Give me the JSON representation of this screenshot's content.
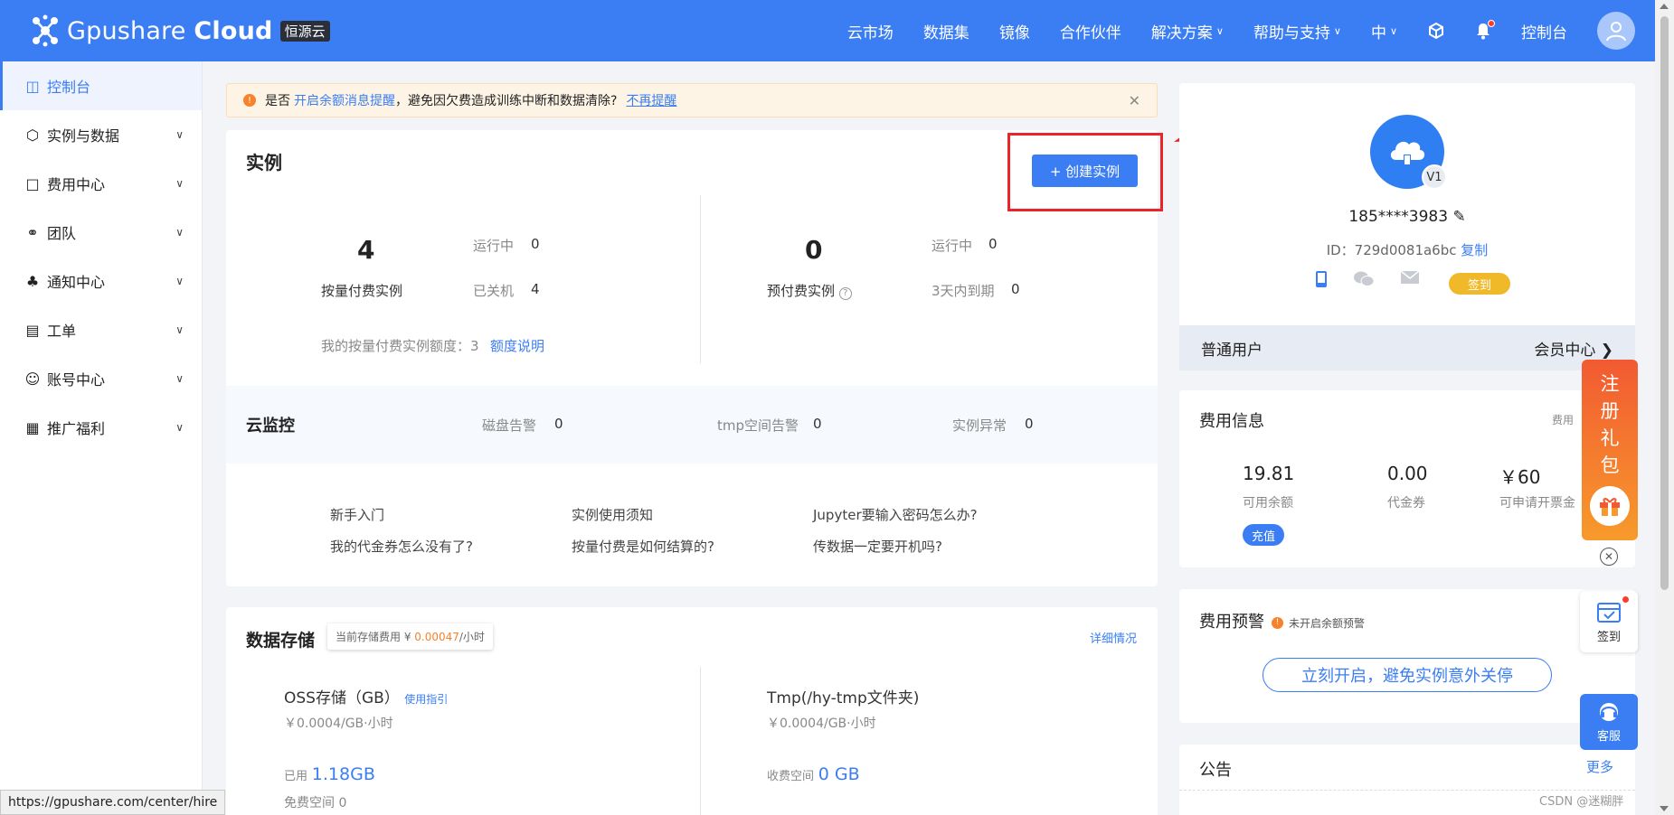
{
  "header": {
    "logo_text_a": "Gpushare ",
    "logo_text_b": "Cloud",
    "logo_badge": "恒源云",
    "nav": [
      "云市场",
      "数据集",
      "镜像",
      "合作伙伴",
      "解决方案",
      "帮助与支持",
      "中",
      "控制台"
    ]
  },
  "sidebar": {
    "items": [
      {
        "label": "控制台"
      },
      {
        "label": "实例与数据"
      },
      {
        "label": "费用中心"
      },
      {
        "label": "团队"
      },
      {
        "label": "通知中心"
      },
      {
        "label": "工单"
      },
      {
        "label": "账号中心"
      },
      {
        "label": "推广福利"
      }
    ]
  },
  "notice": {
    "prefix": "是否",
    "link1": "开启余额消息提醒",
    "middle": "，避免因欠费造成训练中断和数据清除?",
    "link2": "不再提醒"
  },
  "instances": {
    "title": "实例",
    "create_button": "+ 创建实例",
    "payg_count": "4",
    "payg_label": "按量付费实例",
    "running_label": "运行中",
    "payg_running": "0",
    "stopped_label": "已关机",
    "payg_stopped": "4",
    "quota_text": "我的按量付费实例额度：3",
    "quota_link": "额度说明",
    "prepaid_count": "0",
    "prepaid_label": "预付费实例",
    "prepaid_running": "0",
    "expire_label": "3天内到期",
    "prepaid_expire": "0"
  },
  "monitor": {
    "title": "云监控",
    "disk_label": "磁盘告警",
    "disk_value": "0",
    "tmp_label": "tmp空间告警",
    "tmp_value": "0",
    "err_label": "实例异常",
    "err_value": "0"
  },
  "faq": [
    "新手入门",
    "实例使用须知",
    "Jupyter要输入密码怎么办?",
    "我的代金券怎么没有了?",
    "按量付费是如何结算的?",
    "传数据一定要开机吗?"
  ],
  "storage": {
    "title": "数据存储",
    "tooltip_prefix": "当前存储费用 ¥ ",
    "tooltip_value": "0.00047",
    "tooltip_suffix": "/小时",
    "detail_link": "详细情况",
    "oss_title": "OSS存储（GB）",
    "oss_guide": "使用指引",
    "oss_price": "￥0.0004/GB·小时",
    "used_label": "已用",
    "used_value": "1.18GB",
    "free_label": "免费空间 0",
    "tmp_title": "Tmp(/hy-tmp文件夹)",
    "tmp_price": "￥0.0004/GB·小时",
    "charged_label": "收费空间",
    "charged_value": "0 GB"
  },
  "profile": {
    "phone": "185****3983",
    "id_label": "ID：729d0081a6bc",
    "copy": "复制",
    "sign_button": "签到",
    "level": "V1",
    "user_type": "普通用户",
    "member_center": "会员中心"
  },
  "fee": {
    "title": "费用信息",
    "detail_partial": "费用",
    "balance": "19.81",
    "balance_label": "可用余额",
    "voucher": "0.00",
    "voucher_label": "代金券",
    "invoice": "￥60",
    "invoice_label": "可申请开票金",
    "recharge": "充值"
  },
  "warning": {
    "title": "费用预警",
    "status": "未开启余额预警",
    "button": "立刻开启，避免实例意外关停"
  },
  "announce": {
    "title": "公告",
    "more": "更多"
  },
  "floating": {
    "gift_chars": [
      "注",
      "册",
      "礼",
      "包"
    ],
    "sign": "签到",
    "service": "客服"
  },
  "status_url": "https://gpushare.com/center/hire",
  "watermark": "CSDN @迷糊胖",
  "colors": {
    "primary": "#3b7ef3",
    "warning": "#f7822c",
    "highlight": "#e8262a",
    "gold": "#f0b92a"
  }
}
